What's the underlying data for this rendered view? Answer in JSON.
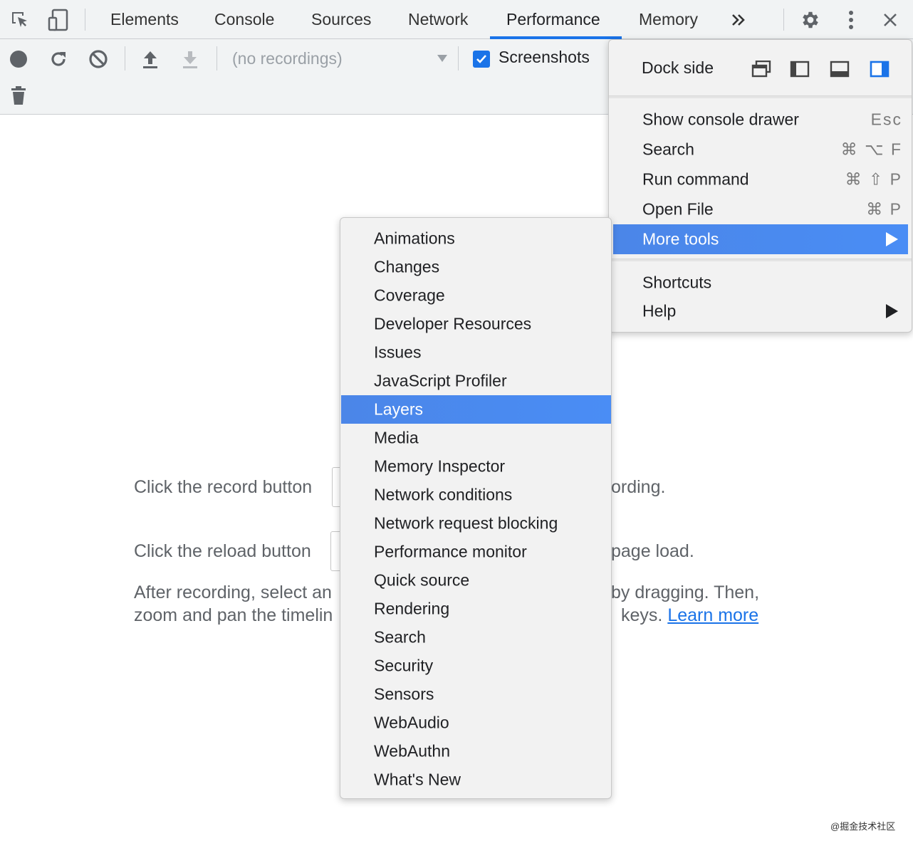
{
  "tabs": [
    {
      "label": "Elements",
      "active": false
    },
    {
      "label": "Console",
      "active": false
    },
    {
      "label": "Sources",
      "active": false
    },
    {
      "label": "Network",
      "active": false
    },
    {
      "label": "Performance",
      "active": true
    },
    {
      "label": "Memory",
      "active": false
    }
  ],
  "toolbar": {
    "recordings_placeholder": "(no recordings)",
    "screenshots_label": "Screenshots",
    "screenshots_checked": true
  },
  "landing": {
    "record_pre": "Click the record button",
    "record_post": "ording.",
    "reload_pre": "Click the reload button",
    "reload_post": "page load.",
    "after_line1_pre": "After recording, select an",
    "after_line1_post": "by dragging. Then,",
    "after_line2_pre": "zoom and pan the timelin",
    "after_line2_post": "keys.",
    "learn_more": "Learn more"
  },
  "main_menu": {
    "dock_side_label": "Dock side",
    "items": [
      {
        "label": "Show console drawer",
        "shortcut": "Esc"
      },
      {
        "label": "Search",
        "shortcut": "⌘ ⌥ F"
      },
      {
        "label": "Run command",
        "shortcut": "⌘ ⇧ P"
      },
      {
        "label": "Open File",
        "shortcut": "⌘ P"
      },
      {
        "label": "More tools",
        "shortcut": "",
        "highlighted": true,
        "has_submenu": true
      },
      {
        "label": "Shortcuts",
        "shortcut": ""
      },
      {
        "label": "Help",
        "shortcut": "",
        "has_submenu": true
      }
    ]
  },
  "more_tools": [
    "Animations",
    "Changes",
    "Coverage",
    "Developer Resources",
    "Issues",
    "JavaScript Profiler",
    "Layers",
    "Media",
    "Memory Inspector",
    "Network conditions",
    "Network request blocking",
    "Performance monitor",
    "Quick source",
    "Rendering",
    "Search",
    "Security",
    "Sensors",
    "WebAudio",
    "WebAuthn",
    "What's New"
  ],
  "more_tools_highlighted": "Layers",
  "watermark": "@掘金技术社区",
  "colors": {
    "accent": "#1a73e8",
    "menu_highlight": "#4a86e8"
  }
}
